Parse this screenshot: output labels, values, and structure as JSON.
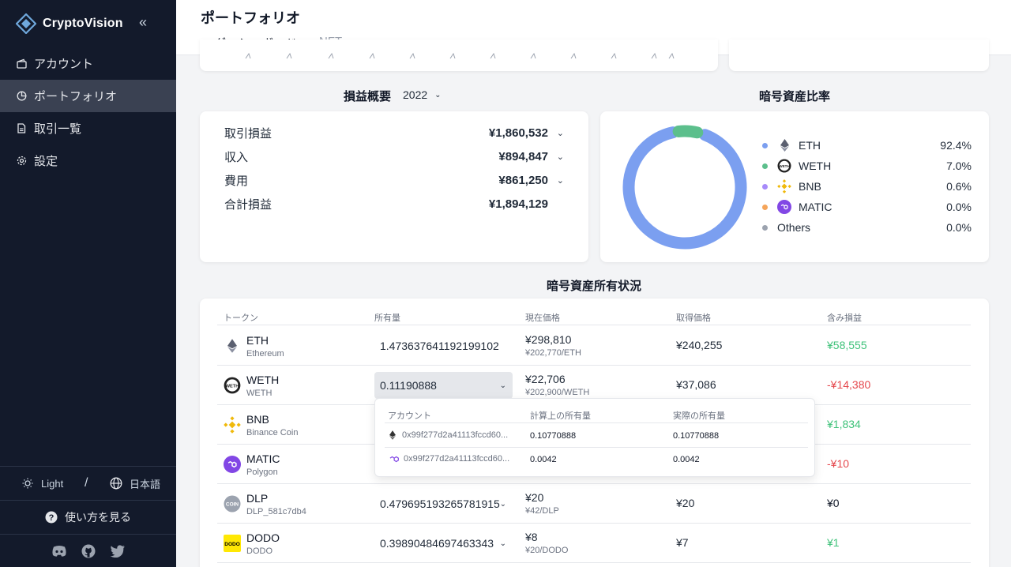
{
  "app": {
    "name": "CryptoVision",
    "collapse_icon": "double-chevron-left-icon"
  },
  "sidebar": {
    "items": [
      {
        "label": "アカウント",
        "icon": "wallet-icon",
        "active": false
      },
      {
        "label": "ポートフォリオ",
        "icon": "pie-chart-icon",
        "active": true
      },
      {
        "label": "取引一覧",
        "icon": "document-icon",
        "active": false
      },
      {
        "label": "設定",
        "icon": "gear-icon",
        "active": false
      }
    ],
    "theme_label": "Light",
    "separator": "/",
    "language_label": "日本語",
    "help_label": "使い方を見る",
    "social": [
      "discord-icon",
      "github-icon",
      "twitter-icon"
    ]
  },
  "header": {
    "title": "ポートフォリオ",
    "tabs": [
      {
        "label": "ダッシュボード",
        "active": true
      },
      {
        "label": "NFT",
        "active": false
      }
    ]
  },
  "pl": {
    "title": "損益概要",
    "year": "2022",
    "rows": [
      {
        "label": "取引損益",
        "value": "¥1,860,532",
        "expandable": true
      },
      {
        "label": "収入",
        "value": "¥894,847",
        "expandable": true
      },
      {
        "label": "費用",
        "value": "¥861,250",
        "expandable": true
      },
      {
        "label": "合計損益",
        "value": "¥1,894,129",
        "expandable": false
      }
    ]
  },
  "allocation": {
    "title": "暗号資産比率",
    "items": [
      {
        "name": "ETH",
        "pct": "92.4%",
        "color": "#7b9ff0",
        "icon": "eth-icon"
      },
      {
        "name": "WETH",
        "pct": "7.0%",
        "color": "#5cbf8c",
        "icon": "weth-icon"
      },
      {
        "name": "BNB",
        "pct": "0.6%",
        "color": "#a78bfa",
        "icon": "bnb-icon"
      },
      {
        "name": "MATIC",
        "pct": "0.0%",
        "color": "#f5a55a",
        "icon": "matic-icon"
      },
      {
        "name": "Others",
        "pct": "0.0%",
        "color": "#9ca3af",
        "icon": ""
      }
    ]
  },
  "holdings": {
    "title": "暗号資産所有状況",
    "columns": [
      "トークン",
      "所有量",
      "現在価格",
      "取得価格",
      "含み損益"
    ],
    "rows": [
      {
        "symbol": "ETH",
        "name": "Ethereum",
        "amount": "1.473637641192199102",
        "price": "¥298,810",
        "price_sub": "¥202,770/ETH",
        "cost": "¥240,255",
        "gain": "¥58,555",
        "gain_type": "pos",
        "icon": "eth-icon"
      },
      {
        "symbol": "WETH",
        "name": "WETH",
        "amount": "0.11190888",
        "price": "¥22,706",
        "price_sub": "¥202,900/WETH",
        "cost": "¥37,086",
        "gain": "-¥14,380",
        "gain_type": "neg",
        "icon": "weth-icon"
      },
      {
        "symbol": "BNB",
        "name": "Binance Coin",
        "amount": "",
        "price": "",
        "price_sub": "",
        "cost": "",
        "gain": "¥1,834",
        "gain_type": "pos",
        "icon": "bnb-icon"
      },
      {
        "symbol": "MATIC",
        "name": "Polygon",
        "amount": "",
        "price": "",
        "price_sub": "",
        "cost": "",
        "gain": "-¥10",
        "gain_type": "neg",
        "icon": "matic-icon"
      },
      {
        "symbol": "DLP",
        "name": "DLP_581c7db4",
        "amount": "0.479695193265781915",
        "price": "¥20",
        "price_sub": "¥42/DLP",
        "cost": "¥20",
        "gain": "¥0",
        "gain_type": "zero",
        "icon": "coin-icon"
      },
      {
        "symbol": "DODO",
        "name": "DODO",
        "amount": "0.39890484697463343",
        "price": "¥8",
        "price_sub": "¥20/DODO",
        "cost": "¥7",
        "gain": "¥1",
        "gain_type": "pos",
        "icon": "dodo-icon"
      }
    ],
    "popup": {
      "columns": [
        "アカウント",
        "計算上の所有量",
        "実際の所有量"
      ],
      "rows": [
        {
          "address": "0x99f277d2a41113fccd60...",
          "calc": "0.10770888",
          "actual": "0.10770888",
          "icon": "eth-icon"
        },
        {
          "address": "0x99f277d2a41113fccd60...",
          "calc": "0.0042",
          "actual": "0.0042",
          "icon": "matic-icon"
        }
      ]
    }
  },
  "colors": {
    "sidebar_bg": "#131a2b",
    "positive": "#3fc27a",
    "negative": "#e5484d"
  },
  "chart_data": {
    "type": "pie",
    "categories": [
      "ETH",
      "WETH",
      "BNB",
      "MATIC",
      "Others"
    ],
    "values": [
      92.4,
      7.0,
      0.6,
      0.0,
      0.0
    ],
    "title": "暗号資産比率",
    "legend": "right"
  }
}
